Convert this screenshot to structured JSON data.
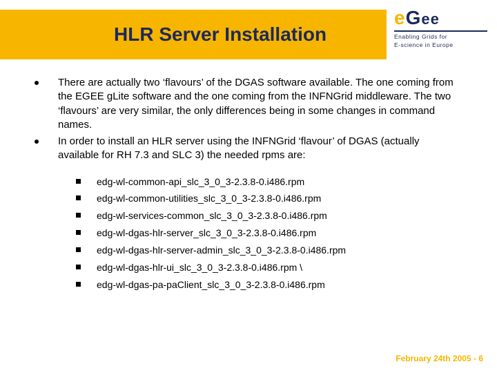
{
  "title": "HLR Server Installation",
  "logo": {
    "text": "eGee",
    "tagline_line1": "Enabling Grids for",
    "tagline_line2": "E-science in Europe"
  },
  "bullets": [
    "There are actually two ‘flavours’ of the DGAS software available. The one coming from the EGEE gLite software and the one coming from the INFNGrid middleware. The two ‘flavours’ are very similar, the only differences being in some changes in command names.",
    "In order to install an HLR server using the INFNGrid ‘flavour’ of DGAS (actually available for RH 7.3 and SLC 3) the needed rpms are:"
  ],
  "sub_bullets": [
    "edg-wl-common-api_slc_3_0_3-2.3.8-0.i486.rpm",
    "edg-wl-common-utilities_slc_3_0_3-2.3.8-0.i486.rpm",
    "edg-wl-services-common_slc_3_0_3-2.3.8-0.i486.rpm",
    "edg-wl-dgas-hlr-server_slc_3_0_3-2.3.8-0.i486.rpm",
    "edg-wl-dgas-hlr-server-admin_slc_3_0_3-2.3.8-0.i486.rpm",
    "edg-wl-dgas-hlr-ui_slc_3_0_3-2.3.8-0.i486.rpm \\",
    "edg-wl-dgas-pa-paClient_slc_3_0_3-2.3.8-0.i486.rpm"
  ],
  "footer": "February 24th 2005 - 6"
}
